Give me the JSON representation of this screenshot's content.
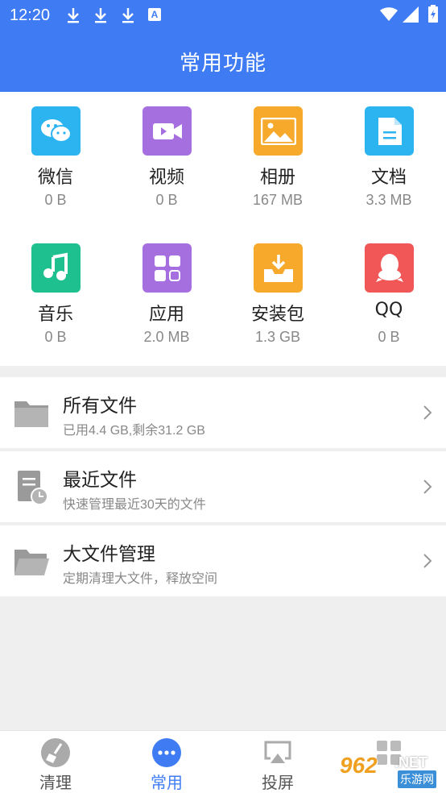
{
  "status_bar": {
    "time": "12:20",
    "notification_letter": "A"
  },
  "header": {
    "title": "常用功能"
  },
  "categories": [
    {
      "label": "微信",
      "size": "0 B",
      "icon": "wechat-icon",
      "color": "#2cb4f0"
    },
    {
      "label": "视频",
      "size": "0 B",
      "icon": "video-icon",
      "color": "#a66fe0"
    },
    {
      "label": "相册",
      "size": "167 MB",
      "icon": "image-icon",
      "color": "#f6a92b"
    },
    {
      "label": "文档",
      "size": "3.3 MB",
      "icon": "document-icon",
      "color": "#2cb4f0"
    },
    {
      "label": "音乐",
      "size": "0 B",
      "icon": "music-icon",
      "color": "#1fc08f"
    },
    {
      "label": "应用",
      "size": "2.0 MB",
      "icon": "apps-icon",
      "color": "#a66fe0"
    },
    {
      "label": "安装包",
      "size": "1.3 GB",
      "icon": "package-icon",
      "color": "#f6a92b"
    },
    {
      "label": "QQ",
      "size": "0 B",
      "icon": "qq-icon",
      "color": "#f25757"
    }
  ],
  "list": [
    {
      "title": "所有文件",
      "subtitle": "已用4.4 GB,剩余31.2 GB",
      "icon": "folder-icon"
    },
    {
      "title": "最近文件",
      "subtitle": "快速管理最近30天的文件",
      "icon": "recent-file-icon"
    },
    {
      "title": "大文件管理",
      "subtitle": "定期清理大文件，释放空间",
      "icon": "folder-open-icon"
    }
  ],
  "tabs": [
    {
      "label": "清理",
      "icon": "broom-icon",
      "active": false
    },
    {
      "label": "常用",
      "icon": "more-icon",
      "active": true
    },
    {
      "label": "投屏",
      "icon": "cast-icon",
      "active": false
    },
    {
      "label": "",
      "icon": "grid-icon",
      "active": false
    }
  ],
  "watermark": {
    "number": "962",
    "suffix": ".NET",
    "text": "乐游网"
  },
  "colors": {
    "accent": "#3f7cf4",
    "inactive_tab": "#555555"
  }
}
